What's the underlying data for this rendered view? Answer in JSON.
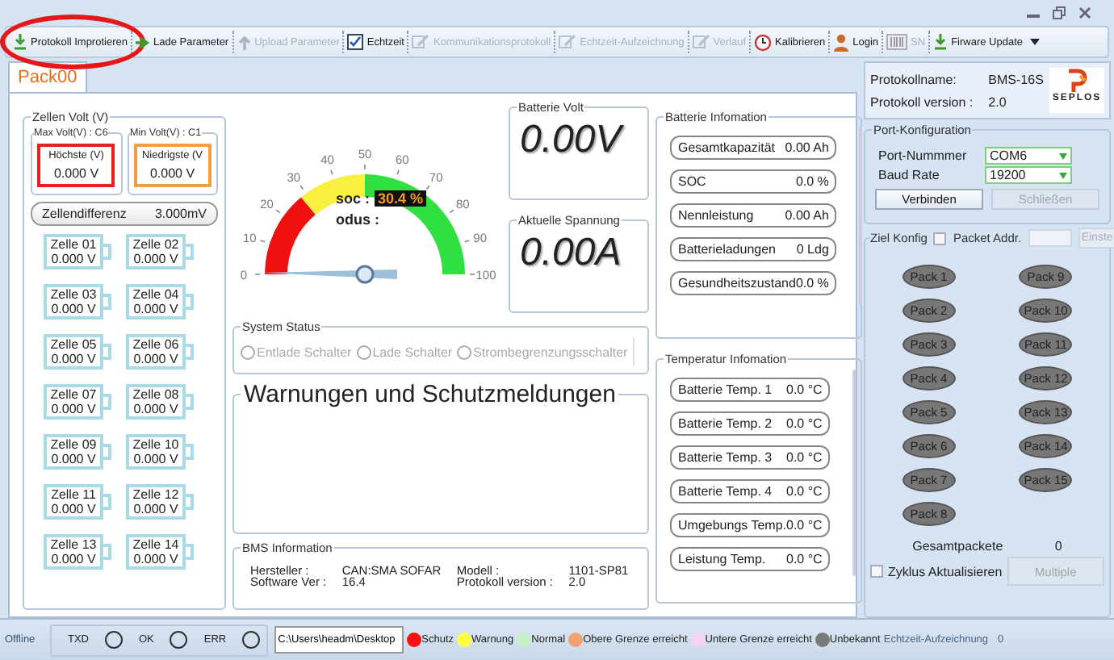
{
  "toolbar": {
    "items": [
      {
        "label": "Protokoll Improtieren",
        "kind": "import",
        "disabled": false,
        "circled": true
      },
      {
        "label": "Lade Parameter",
        "kind": "load",
        "disabled": false,
        "circled": false
      },
      {
        "label": "Upload Parameter",
        "kind": "upload",
        "disabled": true,
        "circled": false
      },
      {
        "label": "Echtzeit",
        "kind": "check",
        "disabled": false,
        "circled": false
      },
      {
        "label": "Kommunikationsprotokoll",
        "kind": "edit",
        "disabled": true,
        "circled": false
      },
      {
        "label": "Echtzeit-Aufzeichnung",
        "kind": "edit",
        "disabled": true,
        "circled": false
      },
      {
        "label": "Verlauf",
        "kind": "edit",
        "disabled": true,
        "circled": false
      },
      {
        "label": "Kalibrieren",
        "kind": "clock",
        "disabled": false,
        "circled": false
      },
      {
        "label": "Login",
        "kind": "user",
        "disabled": false,
        "circled": false
      },
      {
        "label": "SN",
        "kind": "barcode",
        "disabled": true,
        "circled": false
      },
      {
        "label": "Firware Update",
        "kind": "import",
        "disabled": false,
        "circled": false
      }
    ]
  },
  "tabs": [
    {
      "label": "Pack00",
      "selected": true
    }
  ],
  "cells": {
    "title": "Zellen Volt (V)",
    "max": {
      "title": "Max Volt(V) : C6",
      "label": "Höchste (V)",
      "value": "0.000 V"
    },
    "min": {
      "title": "Min Volt(V) : C1",
      "label": "Niedrigste (V",
      "value": "0.000 V"
    },
    "difference": {
      "label": "Zellendifferenz",
      "value": "3.000mV"
    },
    "items": [
      {
        "name": "Zelle 01",
        "value": "0.000 V"
      },
      {
        "name": "Zelle 02",
        "value": "0.000 V"
      },
      {
        "name": "Zelle 03",
        "value": "0.000 V"
      },
      {
        "name": "Zelle 04",
        "value": "0.000 V"
      },
      {
        "name": "Zelle 05",
        "value": "0.000 V"
      },
      {
        "name": "Zelle 06",
        "value": "0.000 V"
      },
      {
        "name": "Zelle 07",
        "value": "0.000 V"
      },
      {
        "name": "Zelle 08",
        "value": "0.000 V"
      },
      {
        "name": "Zelle 09",
        "value": "0.000 V"
      },
      {
        "name": "Zelle 10",
        "value": "0.000 V"
      },
      {
        "name": "Zelle 11",
        "value": "0.000 V"
      },
      {
        "name": "Zelle 12",
        "value": "0.000 V"
      },
      {
        "name": "Zelle 13",
        "value": "0.000 V"
      },
      {
        "name": "Zelle 14",
        "value": "0.000 V"
      }
    ]
  },
  "gauge": {
    "ticks": [
      "0",
      "10",
      "20",
      "30",
      "40",
      "50",
      "60",
      "70",
      "80",
      "90",
      "100"
    ],
    "soc_label": "soc :",
    "soc_value": "30.4 %",
    "mode_label": "odus :"
  },
  "battery_volt": {
    "title": "Batterie Volt",
    "value": "0.00V"
  },
  "current": {
    "title": "Aktuelle Spannung",
    "value": "0.00A"
  },
  "system_status": {
    "title": "System Status",
    "options": [
      {
        "label": "Entlade Schalter",
        "selected": false
      },
      {
        "label": "Lade Schalter",
        "selected": false
      },
      {
        "label": "Strombegrenzungsschalter",
        "selected": false
      }
    ]
  },
  "warnings": {
    "title": "Warnungen und Schutzmeldungen"
  },
  "bms_info": {
    "title": "BMS Information",
    "fields": [
      {
        "label": "Hersteller :",
        "value": "CAN:SMA SOFAR"
      },
      {
        "label": "Software Ver :",
        "value": "16.4"
      },
      {
        "label": "Modell :",
        "value": "1101-SP81"
      },
      {
        "label": "Protokoll version :",
        "value": "2.0"
      }
    ]
  },
  "battery_info": {
    "title": "Batterie Infomation",
    "rows": [
      {
        "label": "Gesamtkapazität",
        "value": "0.00 Ah"
      },
      {
        "label": "SOC",
        "value": "0.0 %"
      },
      {
        "label": "Nennleistung",
        "value": "0.00 Ah"
      },
      {
        "label": "Batterieladungen",
        "value": "0 Ldg"
      },
      {
        "label": "Gesundheitszustand",
        "value": "0.0 %"
      }
    ]
  },
  "temperature_info": {
    "title": "Temperatur Infomation",
    "rows": [
      {
        "label": "Batterie Temp. 1",
        "value": "0.0 °C"
      },
      {
        "label": "Batterie Temp. 2",
        "value": "0.0 °C"
      },
      {
        "label": "Batterie Temp. 3",
        "value": "0.0 °C"
      },
      {
        "label": "Batterie Temp. 4",
        "value": "0.0 °C"
      },
      {
        "label": "Umgebungs Temp.",
        "value": "0.0 °C"
      },
      {
        "label": "Leistung Temp.",
        "value": "0.0 °C"
      }
    ]
  },
  "protocol": {
    "name_label": "Protokollname:",
    "name": "BMS-16S",
    "version_label": "Protokoll version :",
    "version": "2.0",
    "logo_text": "SEPLOS"
  },
  "port_config": {
    "title": "Port-Konfiguration",
    "port_label": "Port-Nummmer",
    "port": "COM6",
    "baud_label": "Baud Rate",
    "baud": "19200",
    "connect": {
      "label": "Verbinden",
      "disabled": false
    },
    "close": {
      "label": "Schließen",
      "disabled": true
    }
  },
  "target": {
    "title": "Ziel Konfig",
    "packet_addr": {
      "label": "Packet Addr.",
      "checked": false
    },
    "set_button": {
      "label": "Einste",
      "disabled": true
    },
    "packs": [
      {
        "label": "Pack 1"
      },
      {
        "label": "Pack 2"
      },
      {
        "label": "Pack 3"
      },
      {
        "label": "Pack 4"
      },
      {
        "label": "Pack 5"
      },
      {
        "label": "Pack 6"
      },
      {
        "label": "Pack 7"
      },
      {
        "label": "Pack 8"
      },
      {
        "label": "Pack 9"
      },
      {
        "label": "Pack 10"
      },
      {
        "label": "Pack 11"
      },
      {
        "label": "Pack 12"
      },
      {
        "label": "Pack 13"
      },
      {
        "label": "Pack 14"
      },
      {
        "label": "Pack 15"
      }
    ],
    "total_label": "Gesamtpackete",
    "total": "0",
    "cycle": {
      "label": "Zyklus Aktualisieren",
      "checked": false
    },
    "multiple": {
      "label": "Multiple",
      "disabled": true
    }
  },
  "status_bar": {
    "connection": "Offline",
    "indicators": [
      {
        "label": "TXD",
        "on": false
      },
      {
        "label": "OK",
        "on": false
      },
      {
        "label": "ERR",
        "on": false
      }
    ],
    "path": "C:\\Users\\headm\\Desktop",
    "legend": [
      {
        "label": "Schutz",
        "color": "#ff1010"
      },
      {
        "label": "Warnung",
        "color": "#ffff40"
      },
      {
        "label": "Normal",
        "color": "#c4f2c4"
      },
      {
        "label": "Obere Grenze erreicht",
        "color": "#f4a070"
      },
      {
        "label": "Untere Grenze erreicht",
        "color": "#f4d4f0"
      },
      {
        "label": "Unbekannt",
        "color": "#7a7a7a"
      }
    ],
    "recording": {
      "label": "Echtzeit-Aufzeichnung",
      "count": "0"
    }
  }
}
